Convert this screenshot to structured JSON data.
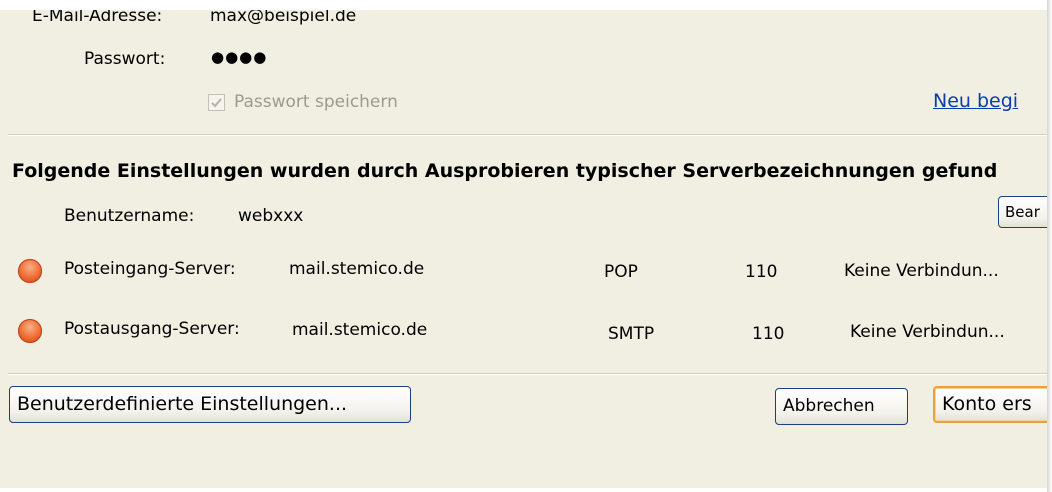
{
  "email": {
    "label": "E-Mail-Adresse:",
    "value": "max@beispiel.de"
  },
  "password": {
    "label": "Passwort:",
    "value": "●●●●"
  },
  "remember": {
    "label": "Passwort speichern",
    "checked": true
  },
  "restart_link": "Neu begi",
  "found_heading": "Folgende Einstellungen wurden durch Ausprobieren typischer Serverbezeichnungen gefund",
  "username": {
    "label": "Benutzername:",
    "value": "webxxx",
    "edit_button": "Bear"
  },
  "servers": [
    {
      "label": "Posteingang-Server:",
      "host": "mail.stemico.de",
      "protocol": "POP",
      "port": "110",
      "status": "Keine Verbindun..."
    },
    {
      "label": "Postausgang-Server:",
      "host": "mail.stemico.de",
      "protocol": "SMTP",
      "port": "110",
      "status": "Keine Verbindun..."
    }
  ],
  "buttons": {
    "custom": "Benutzerdefinierte Einstellungen...",
    "cancel": "Abbrechen",
    "create": "Konto ers"
  },
  "colors": {
    "status_error": "#ee6a30",
    "link": "#0a3ea8",
    "default_button_border": "#e9a23b",
    "dialog_bg": "#f1efe2"
  }
}
